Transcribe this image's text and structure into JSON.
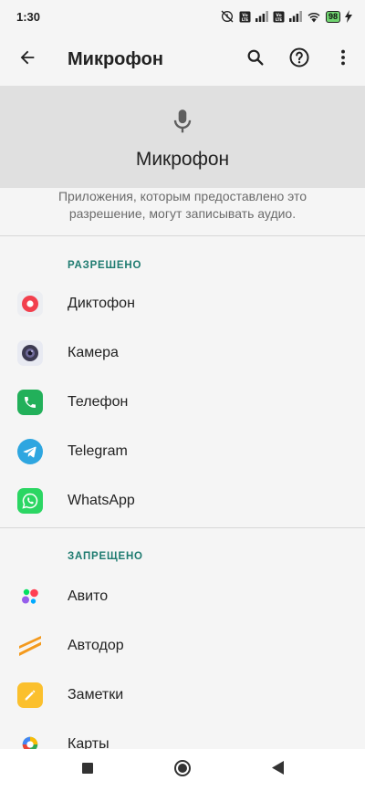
{
  "status_bar": {
    "time": "1:30",
    "battery": "98",
    "network_label_1": "VoLTE",
    "network_label_2": "VoLTE"
  },
  "app_bar": {
    "title": "Микрофон",
    "back_icon": "arrow-back-icon",
    "search_icon": "search-icon",
    "help_icon": "help-icon",
    "more_icon": "more-vert-icon"
  },
  "header": {
    "icon": "microphone-icon",
    "title": "Микрофон"
  },
  "description": "Приложения, которым предоставлено это разрешение, могут записывать аудио.",
  "allowed": {
    "label": "РАЗРЕШЕНО",
    "apps": [
      {
        "name": "Диктофон",
        "icon": "recorder-icon"
      },
      {
        "name": "Камера",
        "icon": "camera-icon"
      },
      {
        "name": "Телефон",
        "icon": "phone-icon"
      },
      {
        "name": "Telegram",
        "icon": "telegram-icon"
      },
      {
        "name": "WhatsApp",
        "icon": "whatsapp-icon"
      }
    ]
  },
  "denied": {
    "label": "ЗАПРЕЩЕНО",
    "apps": [
      {
        "name": "Авито",
        "icon": "avito-icon"
      },
      {
        "name": "Автодор",
        "icon": "avtodor-icon"
      },
      {
        "name": "Заметки",
        "icon": "notes-icon"
      },
      {
        "name": "Карты",
        "icon": "maps-icon"
      }
    ]
  },
  "colors": {
    "accent": "#1e7b70",
    "header_bg": "#e0e0e0",
    "background": "#f5f5f5"
  },
  "nav_bar": {
    "recents_icon": "square-icon",
    "home_icon": "home-circle-icon",
    "back_icon": "triangle-back-icon"
  }
}
